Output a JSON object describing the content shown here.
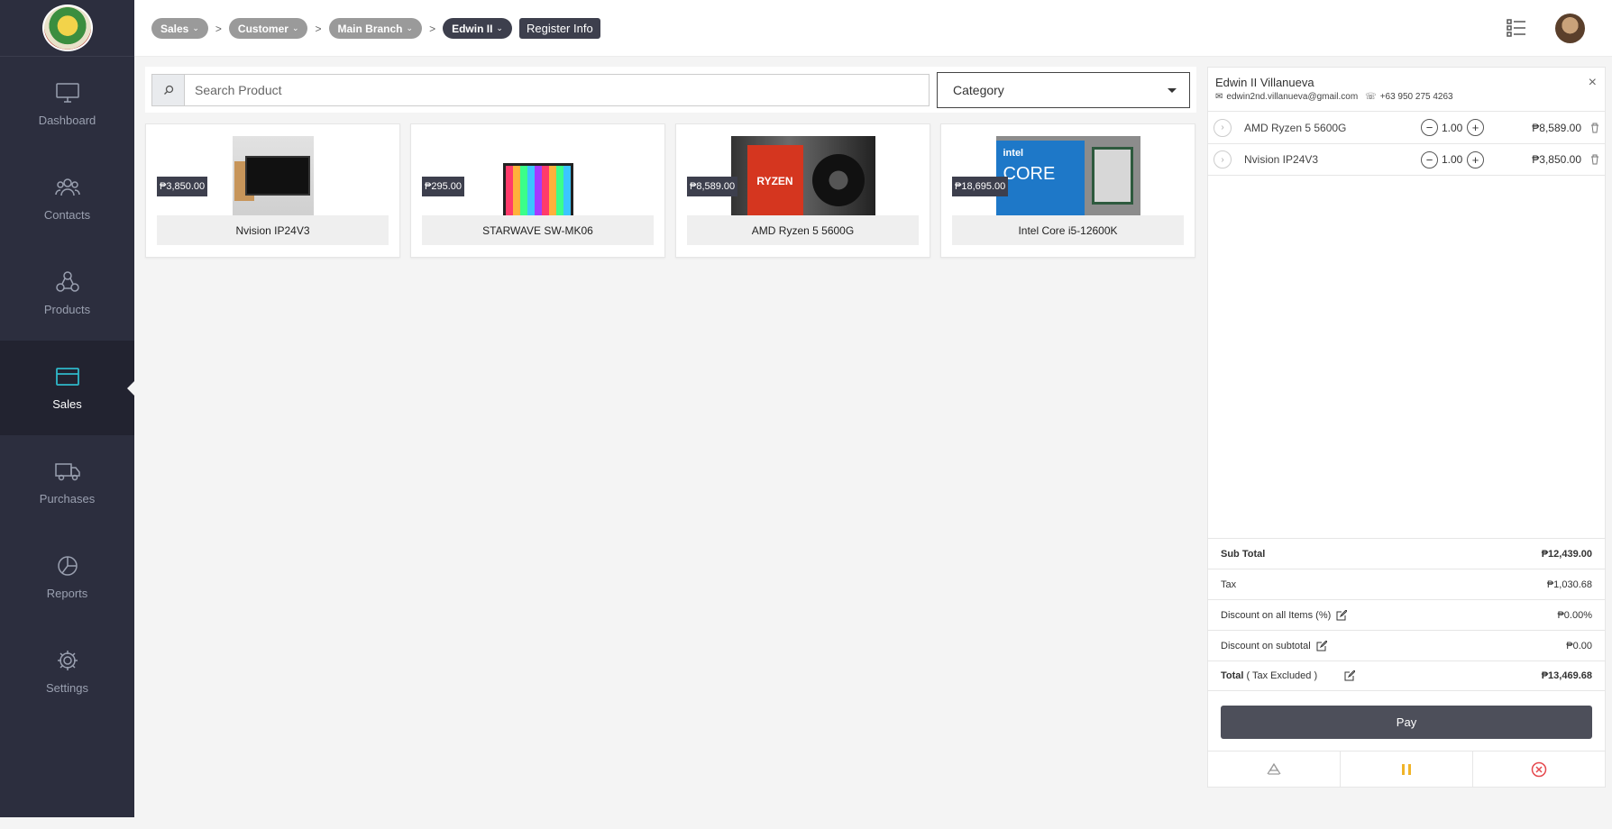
{
  "sidebar": {
    "items": [
      {
        "label": "Dashboard",
        "icon": "monitor-icon"
      },
      {
        "label": "Contacts",
        "icon": "contacts-icon"
      },
      {
        "label": "Products",
        "icon": "products-icon"
      },
      {
        "label": "Sales",
        "icon": "card-icon",
        "active": true
      },
      {
        "label": "Purchases",
        "icon": "truck-icon"
      },
      {
        "label": "Reports",
        "icon": "pie-chart-icon"
      },
      {
        "label": "Settings",
        "icon": "gear-icon"
      }
    ]
  },
  "breadcrumb": {
    "items": [
      "Sales",
      "Customer",
      "Main Branch",
      "Edwin II"
    ],
    "separator": ">",
    "register_label": "Register Info"
  },
  "search": {
    "placeholder": "Search Product"
  },
  "category": {
    "label": "Category"
  },
  "products": [
    {
      "name": "Nvision IP24V3",
      "price": "₱3,850.00"
    },
    {
      "name": "STARWAVE SW-MK06",
      "price": "₱295.00"
    },
    {
      "name": "AMD Ryzen 5 5600G",
      "price": "₱8,589.00"
    },
    {
      "name": "Intel Core i5-12600K",
      "price": "₱18,695.00"
    }
  ],
  "product_images": {
    "ryzen_text": "RYZEN",
    "intel_brand": "intel",
    "intel_core": "CORE"
  },
  "customer": {
    "name": "Edwin II Villanueva",
    "email": "edwin2nd.villanueva@gmail.com",
    "phone": "+63 950 275 4263"
  },
  "cart": {
    "items": [
      {
        "name": "AMD Ryzen 5 5600G",
        "qty": "1.00",
        "amount": "₱8,589.00"
      },
      {
        "name": "Nvision IP24V3",
        "qty": "1.00",
        "amount": "₱3,850.00"
      }
    ],
    "summary": {
      "subtotal_label": "Sub Total",
      "subtotal": "₱12,439.00",
      "tax_label": "Tax",
      "tax": "₱1,030.68",
      "discount_all_label": "Discount on all Items (%)",
      "discount_all": "₱0.00%",
      "discount_sub_label": "Discount on subtotal",
      "discount_sub": "₱0.00",
      "total_label": "Total",
      "total_note": "( Tax Excluded )",
      "total": "₱13,469.68"
    },
    "pay_label": "Pay"
  },
  "colors": {
    "accent": "#2fb8c9",
    "sidebar": "#2c2e3e",
    "pause": "#f0b429",
    "cancel": "#e5484d"
  }
}
